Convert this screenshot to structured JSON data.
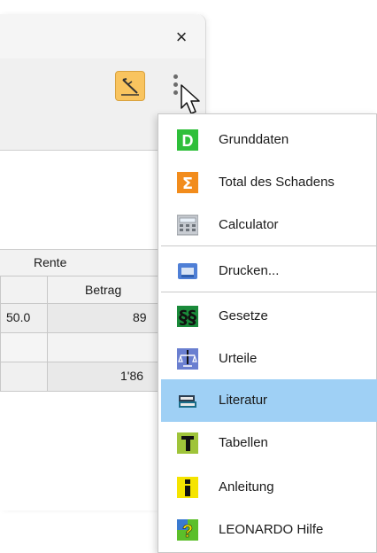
{
  "window": {
    "close_glyph": "×"
  },
  "table": {
    "header_group": "Rente",
    "column_header": "Betrag",
    "rows": [
      {
        "left": "50.0",
        "value": "89"
      },
      {
        "left": "",
        "value": ""
      },
      {
        "left": "",
        "value": "1'86"
      }
    ]
  },
  "menu": {
    "items": [
      {
        "label": "Grunddaten",
        "icon": "grunddaten-icon"
      },
      {
        "label": "Total des Schadens",
        "icon": "sigma-icon"
      },
      {
        "label": "Calculator",
        "icon": "calculator-icon"
      },
      {
        "label": "Drucken...",
        "icon": "printer-icon"
      },
      {
        "label": "Gesetze",
        "icon": "paragraph-icon"
      },
      {
        "label": "Urteile",
        "icon": "scales-icon"
      },
      {
        "label": "Literatur",
        "icon": "books-icon"
      },
      {
        "label": "Tabellen",
        "icon": "table-icon"
      },
      {
        "label": "Anleitung",
        "icon": "info-icon"
      },
      {
        "label": "LEONARDO Hilfe",
        "icon": "help-icon"
      }
    ],
    "selected": "Literatur"
  },
  "colors": {
    "selection": "#9fd0f5",
    "toolbar_button": "#f9c45f",
    "grunddaten_green": "#2fbf3a",
    "sigma_orange": "#f28c1c",
    "help_green": "#5bbf2a"
  }
}
